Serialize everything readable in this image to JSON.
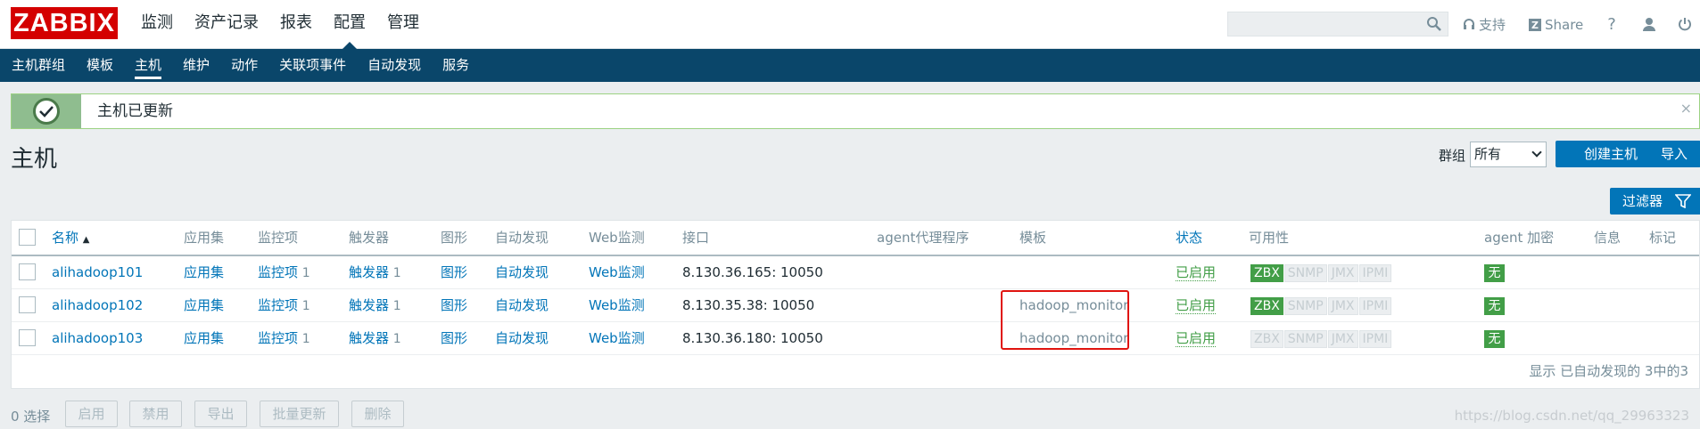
{
  "app": {
    "logo": "ZABBIX",
    "main_nav": [
      "监测",
      "资产记录",
      "报表",
      "配置",
      "管理"
    ],
    "search_placeholder": "",
    "support_label": "支持",
    "share_label": "Share",
    "help_label": "?"
  },
  "sub_nav": [
    "主机群组",
    "模板",
    "主机",
    "维护",
    "动作",
    "关联项事件",
    "自动发现",
    "服务"
  ],
  "message": {
    "text": "主机已更新",
    "close": "×"
  },
  "page": {
    "title": "主机",
    "group_label": "群组",
    "group_value": "所有",
    "create_button": "创建主机",
    "import_button": "导入",
    "filter_button": "过滤器"
  },
  "table": {
    "headers": {
      "name": "名称",
      "sort_indicator": "▲",
      "applications": "应用集",
      "items": "监控项",
      "triggers": "触发器",
      "graphs": "图形",
      "discovery": "自动发现",
      "web": "Web监测",
      "interface": "接口",
      "proxy": "agent代理程序",
      "templates": "模板",
      "status": "状态",
      "availability": "可用性",
      "encryption": "agent 加密",
      "info": "信息",
      "tags": "标记"
    },
    "rows": [
      {
        "name": "alihadoop101",
        "applications": "应用集",
        "items": "监控项",
        "items_count": "1",
        "triggers": "触发器",
        "triggers_count": "1",
        "graphs": "图形",
        "discovery": "自动发现",
        "web": "Web监测",
        "interface": "8.130.36.165: 10050",
        "template": "",
        "status": "已启用",
        "avail": [
          "ZBX",
          "SNMP",
          "JMX",
          "IPMI"
        ],
        "zbx_on": true,
        "encryption": "无"
      },
      {
        "name": "alihadoop102",
        "applications": "应用集",
        "items": "监控项",
        "items_count": "1",
        "triggers": "触发器",
        "triggers_count": "1",
        "graphs": "图形",
        "discovery": "自动发现",
        "web": "Web监测",
        "interface": "8.130.35.38: 10050",
        "template": "hadoop_monitor",
        "status": "已启用",
        "avail": [
          "ZBX",
          "SNMP",
          "JMX",
          "IPMI"
        ],
        "zbx_on": true,
        "encryption": "无"
      },
      {
        "name": "alihadoop103",
        "applications": "应用集",
        "items": "监控项",
        "items_count": "1",
        "triggers": "触发器",
        "triggers_count": "1",
        "graphs": "图形",
        "discovery": "自动发现",
        "web": "Web监测",
        "interface": "8.130.36.180: 10050",
        "template": "hadoop_monitor",
        "status": "已启用",
        "avail": [
          "ZBX",
          "SNMP",
          "JMX",
          "IPMI"
        ],
        "zbx_on": false,
        "encryption": "无"
      }
    ],
    "footer": "显示 已自动发现的 3中的3"
  },
  "actions": {
    "selected": "0 选择",
    "enable": "启用",
    "disable": "禁用",
    "export": "导出",
    "mass_update": "批量更新",
    "delete": "删除"
  },
  "watermark": "https://blog.csdn.net/qq_29963323",
  "colors": {
    "brand_red": "#d40000",
    "nav_blue": "#0a466a",
    "link_blue": "#0275b8",
    "ok_green": "#429e47",
    "highlight_red": "#e0140f"
  }
}
